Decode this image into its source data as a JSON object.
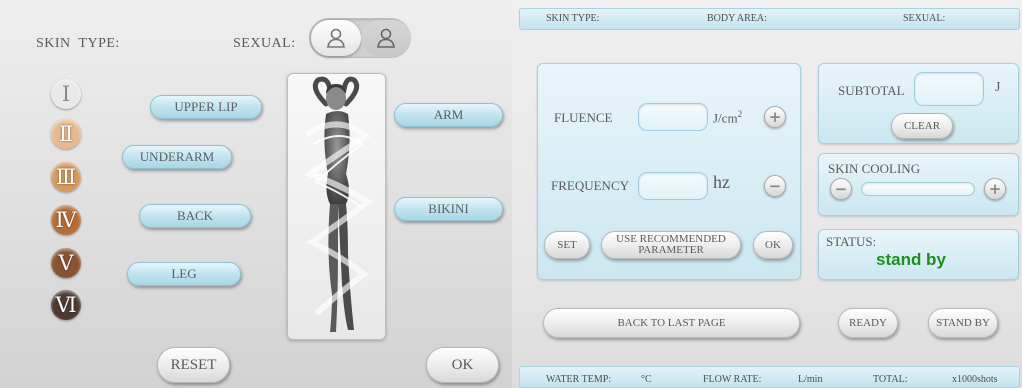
{
  "left": {
    "skin_type_label": "SKIN  TYPE:",
    "sexual_label": "SEXUAL:",
    "sexual_options": [
      {
        "icon": "female-silhouette-icon",
        "selected": true
      },
      {
        "icon": "male-silhouette-icon",
        "selected": false
      }
    ],
    "skin_types": [
      {
        "label": "Ⅰ",
        "color": "#e9e9e9"
      },
      {
        "label": "Ⅱ",
        "color": "#e8b98c"
      },
      {
        "label": "Ⅲ",
        "color": "#d59a5f"
      },
      {
        "label": "Ⅳ",
        "color": "#b76d36"
      },
      {
        "label": "Ⅴ",
        "color": "#875331"
      },
      {
        "label": "Ⅵ",
        "color": "#4f3a31"
      }
    ],
    "areas": {
      "upper_lip": "UPPER LIP",
      "underarm": "UNDERARM",
      "back": "BACK",
      "leg": "LEG",
      "arm": "ARM",
      "bikini": "BIKINI"
    },
    "reset": "RESET",
    "ok": "OK"
  },
  "header": {
    "skin_type": "SKIN TYPE:",
    "body_area": "BODY AREA:",
    "sexual": "SEXUAL:"
  },
  "params": {
    "fluence_label": "FLUENCE",
    "fluence_value": "",
    "fluence_unit": "J/cm",
    "fluence_unit_sup": "2",
    "frequency_label": "FREQUENCY",
    "frequency_value": "",
    "frequency_unit": "hz",
    "set": "SET",
    "use_recommended": "USE  RECOMMENDED PARAMETER",
    "ok": "OK",
    "plus": "+",
    "minus": "−"
  },
  "subtotal": {
    "label": "SUBTOTAL",
    "value": "",
    "unit": "J",
    "clear": "CLEAR"
  },
  "cooling": {
    "label": "SKIN COOLING",
    "minus": "−",
    "plus": "+"
  },
  "status": {
    "label": "STATUS:",
    "value": "stand by"
  },
  "actions": {
    "back": "BACK TO LAST PAGE",
    "ready": "READY",
    "standby": "STAND BY"
  },
  "footer": {
    "water_temp": "WATER TEMP:",
    "water_unit": "°C",
    "flow_rate": "FLOW RATE:",
    "flow_unit": "L/min",
    "total": "TOTAL:",
    "total_unit": "x1000shots"
  },
  "colors": {
    "accent": "#bfe3ef",
    "status_green": "#1b8f1b"
  }
}
